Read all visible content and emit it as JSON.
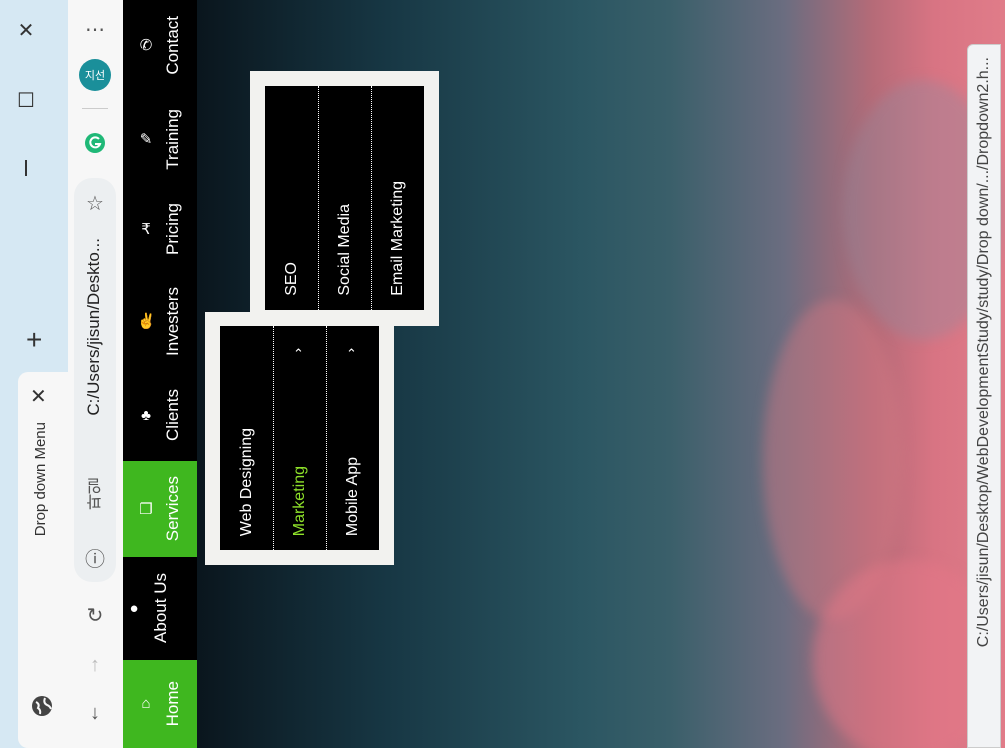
{
  "browser": {
    "tab_title": "Drop down Menu",
    "address_label": "파일",
    "address_url": "C:/Users/jisun/Deskto...",
    "profile_initials": "지선",
    "status_url": "C:/Users/jisun/Desktop/WebDevelopmentStudy/study/Drop down/.../Dropdown2.h..."
  },
  "nav": {
    "items": [
      {
        "label": "Home",
        "icon": "home-icon",
        "active": true
      },
      {
        "label": "About Us",
        "icon": "user-icon",
        "active": false
      },
      {
        "label": "Services",
        "icon": "clone-icon",
        "active": true
      },
      {
        "label": "Clients",
        "icon": "users-icon",
        "active": false
      },
      {
        "label": "Investers",
        "icon": "handshake-icon",
        "active": false
      },
      {
        "label": "Pricing",
        "icon": "rupee-icon",
        "active": false
      },
      {
        "label": "Training",
        "icon": "edit-icon",
        "active": false
      },
      {
        "label": "Contact",
        "icon": "phone-icon",
        "active": false
      }
    ]
  },
  "services_menu": {
    "items": [
      "Web Designing",
      "Marketing",
      "Mobile App"
    ],
    "highlighted": "Marketing"
  },
  "marketing_submenu": {
    "items": [
      "SEO",
      "Social Media",
      "Email Marketing"
    ]
  },
  "colors": {
    "accent": "#3fb71f",
    "highlight_text": "#8ee12a",
    "navbar": "#000000"
  }
}
